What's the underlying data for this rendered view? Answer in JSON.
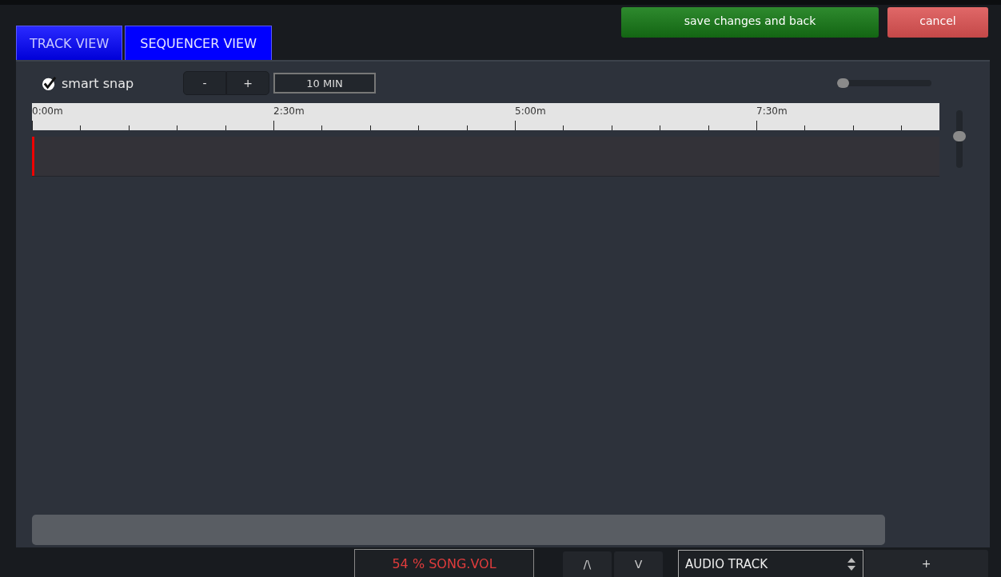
{
  "tabs": [
    {
      "label": "TRACK VIEW",
      "selected": false
    },
    {
      "label": "SEQUENCER VIEW",
      "selected": true
    }
  ],
  "actions": [
    {
      "label": "save changes and back",
      "kind": "save"
    },
    {
      "label": "cancel",
      "kind": "cancel"
    }
  ],
  "toolbar": {
    "smart_snap": {
      "label": "smart snap",
      "checked": true
    },
    "zoom_buttons": [
      "-",
      "+"
    ],
    "range": "10 MIN",
    "zoom_slider": {
      "level": 0
    }
  },
  "ruler": {
    "labels": [
      "0:00m",
      "2:30m",
      "5:00m",
      "7:30m"
    ]
  },
  "vertical_slider": {
    "level": 0.56
  },
  "bottom_bar": {
    "volume": "54 % SONG.VOL",
    "move_buttons": [
      "/\\",
      "V"
    ],
    "track_type": "AUDIO TRACK",
    "add_button": "+"
  }
}
